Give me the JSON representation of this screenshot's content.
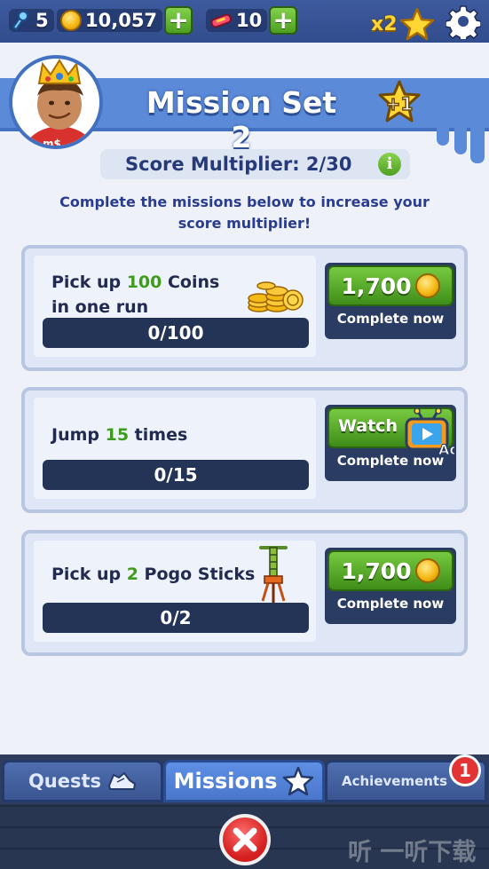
{
  "topbar": {
    "keys": "5",
    "coins": "10,057",
    "boards": "10",
    "multiplier": "x2",
    "icons": {
      "key": "key-icon",
      "coin": "coin-icon",
      "board": "hoverboard-icon",
      "star": "star-icon",
      "settings": "gear-icon"
    }
  },
  "header": {
    "title": "Mission Set 2",
    "bonus": "+1"
  },
  "score_multiplier": "Score Multiplier: 2/30",
  "description": "Complete the missions below to increase your score multiplier!",
  "missions": [
    {
      "text_prefix": "Pick up ",
      "highlight": "100",
      "text_suffix": " Coins in one run",
      "progress": "0/100",
      "reward": "1,700",
      "action": "Complete now"
    },
    {
      "text_prefix": "Jump ",
      "highlight": "15",
      "text_suffix": " times",
      "progress": "0/15",
      "reward": "Watch",
      "ad_label": "Ad",
      "action": "Complete now"
    },
    {
      "text_prefix": "Pick up ",
      "highlight": "2",
      "text_suffix": " Pogo Sticks",
      "progress": "0/2",
      "reward": "1,700",
      "action": "Complete now"
    }
  ],
  "tabs": [
    {
      "label": "Quests",
      "active": false
    },
    {
      "label": "Missions",
      "active": true
    },
    {
      "label": "Achievements",
      "active": false
    }
  ],
  "achievements_badge": "1",
  "watermark": "听 一听下载",
  "colors": {
    "accent_blue": "#5b8ad8",
    "green_button": "#4d9f21",
    "highlight_green": "#3e9c1c",
    "dark_navy": "#243457",
    "close_red": "#d41f1f"
  }
}
